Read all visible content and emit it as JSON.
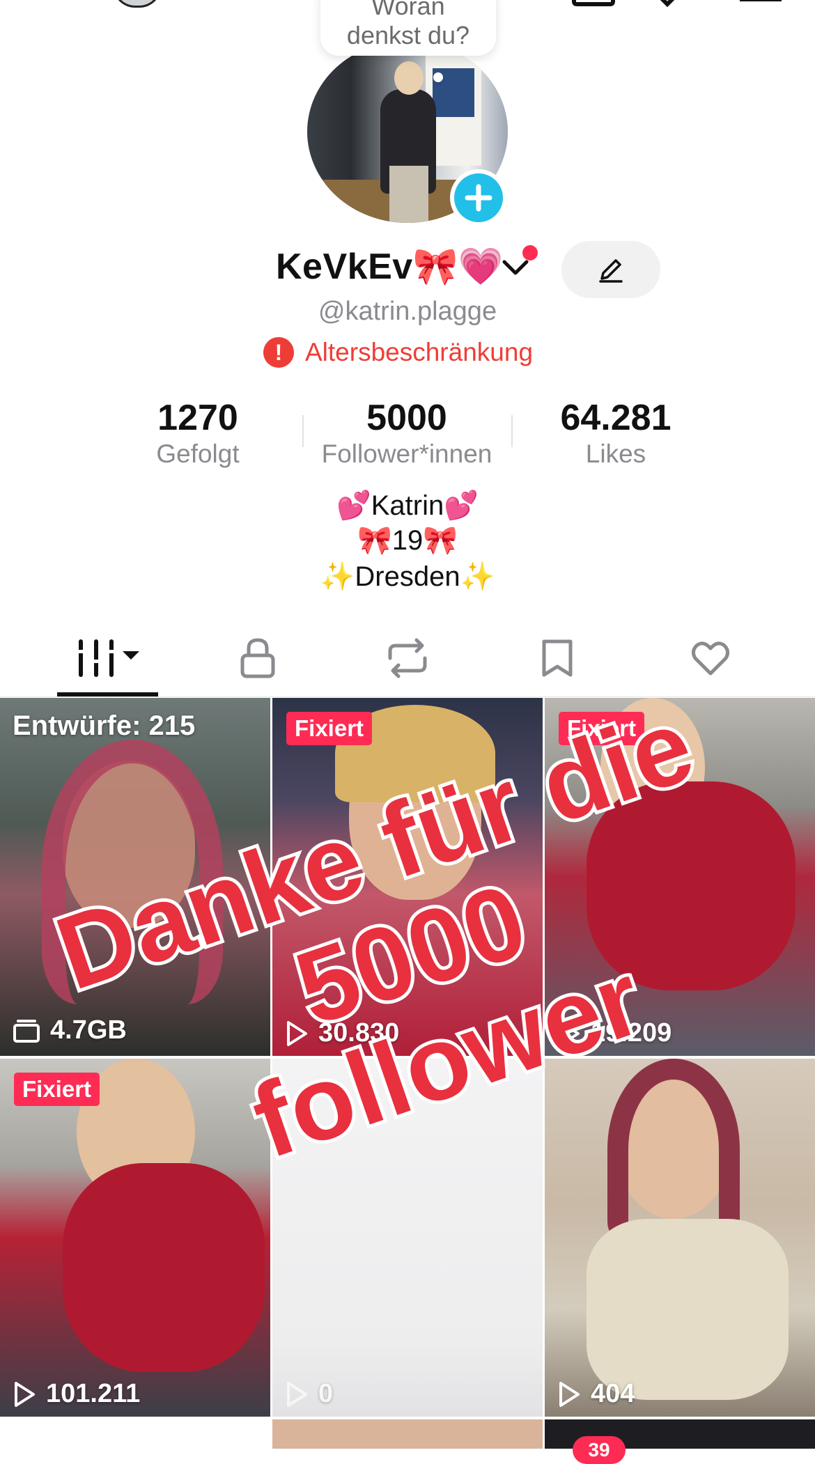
{
  "bubble": {
    "line1": "Woran",
    "line2": "denkst du?"
  },
  "profile": {
    "username": "KeVkEv🎀💗",
    "handle": "@katrin.plagge",
    "restriction": "Altersbeschränkung"
  },
  "stats": [
    {
      "value": "1270",
      "label": "Gefolgt"
    },
    {
      "value": "5000",
      "label": "Follower*innen"
    },
    {
      "value": "64.281",
      "label": "Likes"
    }
  ],
  "bio": [
    "💕Katrin💕",
    "🎀19🎀",
    "✨Dresden✨"
  ],
  "tabs": [
    "videos-grid",
    "private",
    "reposts",
    "bookmarks",
    "liked"
  ],
  "grid": {
    "drafts_label": "Entwürfe: 215",
    "drafts_size": "4.7GB",
    "pinned_label": "Fixiert",
    "views": [
      "30.830",
      "19.209",
      "101.211",
      "0",
      "404"
    ]
  },
  "overlay": {
    "line1": "Danke für die 5000",
    "line2": "follower"
  },
  "bottom_badge": "39",
  "colors": {
    "accent": "#fe2c55",
    "warning": "#ee3d37",
    "add": "#22c0e8"
  }
}
